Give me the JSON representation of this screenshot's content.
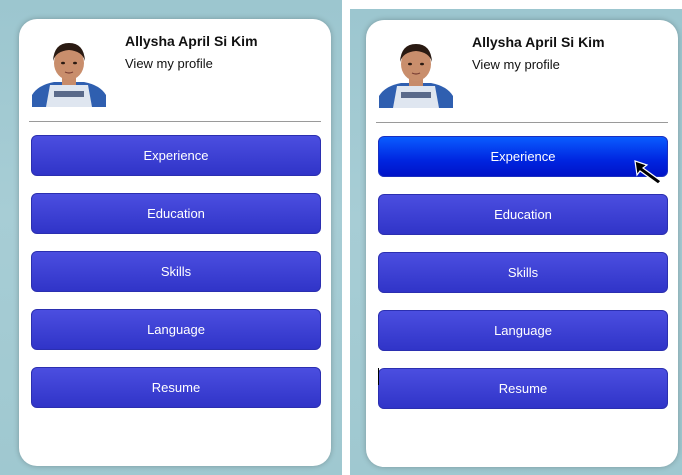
{
  "panels": [
    {
      "profile": {
        "name": "Allysha April Si Kim",
        "link": "View my profile"
      },
      "menu": [
        {
          "label": "Experience",
          "state": "normal"
        },
        {
          "label": "Education",
          "state": "normal"
        },
        {
          "label": "Skills",
          "state": "normal"
        },
        {
          "label": "Language",
          "state": "normal"
        },
        {
          "label": "Resume",
          "state": "normal"
        }
      ]
    },
    {
      "profile": {
        "name": "Allysha April Si Kim",
        "link": "View my profile"
      },
      "menu": [
        {
          "label": "Experience",
          "state": "hover"
        },
        {
          "label": "Education",
          "state": "normal"
        },
        {
          "label": "Skills",
          "state": "normal"
        },
        {
          "label": "Language",
          "state": "normal"
        },
        {
          "label": "Resume",
          "state": "normal"
        }
      ]
    }
  ],
  "colors": {
    "button": "#3a3dd6",
    "button_hover": "#0033ee",
    "background": "#a4cbd3"
  }
}
